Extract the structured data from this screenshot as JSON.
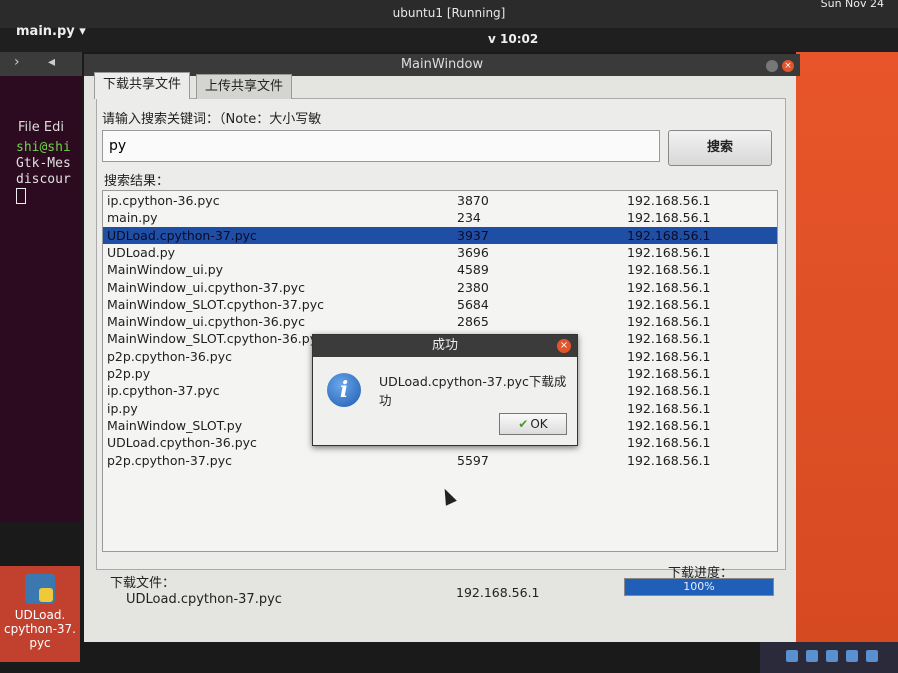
{
  "vm": {
    "title": "ubuntu1 [Running]",
    "clock": "Sun Nov 24"
  },
  "topbar": {
    "tab": "main.py ▾",
    "time": "v 10:02"
  },
  "terminal": {
    "menu": "File  Edi",
    "lines": [
      {
        "text": "shi@shi",
        "color": "#6fd24a"
      },
      {
        "text": "Gtk-Mes",
        "color": "#e0e0e0"
      },
      {
        "text": "discour",
        "color": "#e0e0e0"
      }
    ]
  },
  "desktop_icon": {
    "label_lines": [
      "UDLoad.",
      "cpython-37.",
      "pyc"
    ]
  },
  "window": {
    "title": "MainWindow",
    "tabs": [
      "下载共享文件",
      "上传共享文件"
    ],
    "search_prompt": "请输入搜索关键词：（Note：大小写敏",
    "search_value": "py",
    "search_button": "搜索",
    "results_label": "搜索结果：",
    "results": [
      {
        "name": "ip.cpython-36.pyc",
        "size": "3870",
        "ip": "192.168.56.1"
      },
      {
        "name": "main.py",
        "size": "234",
        "ip": "192.168.56.1"
      },
      {
        "name": "UDLoad.cpython-37.pyc",
        "size": "3937",
        "ip": "192.168.56.1",
        "selected": true
      },
      {
        "name": "UDLoad.py",
        "size": "3696",
        "ip": "192.168.56.1"
      },
      {
        "name": "MainWindow_ui.py",
        "size": "4589",
        "ip": "192.168.56.1"
      },
      {
        "name": "MainWindow_ui.cpython-37.pyc",
        "size": "2380",
        "ip": "192.168.56.1"
      },
      {
        "name": "MainWindow_SLOT.cpython-37.pyc",
        "size": "5684",
        "ip": "192.168.56.1"
      },
      {
        "name": "MainWindow_ui.cpython-36.pyc",
        "size": "2865",
        "ip": "192.168.56.1"
      },
      {
        "name": "MainWindow_SLOT.cpython-36.pyc",
        "size": "",
        "ip": "192.168.56.1"
      },
      {
        "name": "p2p.cpython-36.pyc",
        "size": "",
        "ip": "192.168.56.1"
      },
      {
        "name": "p2p.py",
        "size": "",
        "ip": "192.168.56.1"
      },
      {
        "name": "ip.cpython-37.pyc",
        "size": "",
        "ip": "192.168.56.1"
      },
      {
        "name": "ip.py",
        "size": "",
        "ip": "192.168.56.1"
      },
      {
        "name": "MainWindow_SLOT.py",
        "size": "",
        "ip": "192.168.56.1"
      },
      {
        "name": "UDLoad.cpython-36.pyc",
        "size": "",
        "ip": "192.168.56.1"
      },
      {
        "name": "p2p.cpython-37.pyc",
        "size": "5597",
        "ip": "192.168.56.1"
      }
    ],
    "download_label": "下载文件：",
    "progress_label": "下载进度：",
    "download_file": "UDLoad.cpython-37.pyc",
    "download_ip": "192.168.56.1",
    "progress_text": "100%",
    "progress_value": 1.0
  },
  "dialog": {
    "title": "成功",
    "message": "UDLoad.cpython-37.pyc下载成功",
    "ok_label": "OK"
  },
  "colors": {
    "selection": "#1f4fa5",
    "progress": "#1f5fb8",
    "desktop": "#e8552a"
  }
}
